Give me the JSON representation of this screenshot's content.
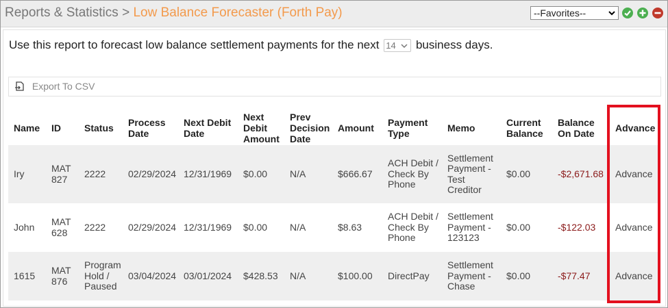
{
  "header": {
    "breadcrumb_parent": "Reports & Statistics",
    "breadcrumb_separator": ">",
    "breadcrumb_current": "Low Balance Forecaster (Forth Pay)",
    "favorites_selected": "--Favorites--"
  },
  "intro": {
    "text_before": "Use this report to forecast low balance settlement payments for the next",
    "days_selected": "14",
    "text_after": "business days."
  },
  "toolbar": {
    "export_label": "Export To CSV"
  },
  "table": {
    "headers": [
      "Name",
      "ID",
      "Status",
      "Process Date",
      "Next Debit Date",
      "Next Debit Amount",
      "Prev Decision Date",
      "Amount",
      "Payment Type",
      "Memo",
      "Current Balance",
      "Balance On Date",
      "Advance"
    ],
    "rows": [
      {
        "name": "Iry",
        "id": "MAT 827",
        "status": "2222",
        "process_date": "02/29/2024",
        "next_debit_date": "12/31/1969",
        "next_debit_amount": "$0.00",
        "prev_decision_date": "N/A",
        "amount": "$666.67",
        "payment_type": "ACH Debit / Check By Phone",
        "memo": "Settlement Payment - Test Creditor",
        "current_balance": "$0.00",
        "balance_on_date": "-$2,671.68",
        "advance": "Advance"
      },
      {
        "name": "John",
        "id": "MAT 628",
        "status": "2222",
        "process_date": "02/29/2024",
        "next_debit_date": "12/31/1969",
        "next_debit_amount": "$0.00",
        "prev_decision_date": "N/A",
        "amount": "$8.63",
        "payment_type": "ACH Debit / Check By Phone",
        "memo": "Settlement Payment - 123123",
        "current_balance": "$0.00",
        "balance_on_date": "-$122.03",
        "advance": "Advance"
      },
      {
        "name": "1615",
        "id": "MAT 876",
        "status": "Program Hold / Paused",
        "process_date": "03/04/2024",
        "next_debit_date": "03/01/2024",
        "next_debit_amount": "$428.53",
        "prev_decision_date": "N/A",
        "amount": "$100.00",
        "payment_type": "DirectPay",
        "memo": "Settlement Payment - Chase",
        "current_balance": "$0.00",
        "balance_on_date": "-$77.47",
        "advance": "Advance"
      }
    ]
  },
  "colors": {
    "breadcrumb_current": "#f39a4c",
    "negative_balance": "#8b1a1a",
    "highlight_box": "#e3101f",
    "add_icon": "#4caf50",
    "remove_icon": "#c0392b"
  },
  "icons": {
    "check": "check-circle-icon",
    "add": "plus-circle-icon",
    "remove": "minus-circle-icon",
    "export": "export-file-icon",
    "dropdown": "chevron-down-icon"
  }
}
